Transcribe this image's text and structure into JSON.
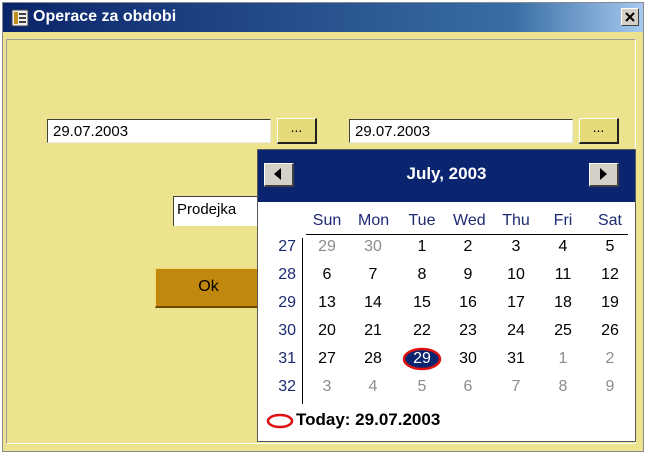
{
  "window": {
    "title": "Operace za obdobi"
  },
  "filters": {
    "date_from": "29.07.2003",
    "date_to": "29.07.2003",
    "picker_button_label": "...",
    "type_value": "Prodejka",
    "ok_label": "Ok"
  },
  "calendar": {
    "month_label": "July, 2003",
    "weekdays": [
      "Sun",
      "Mon",
      "Tue",
      "Wed",
      "Thu",
      "Fri",
      "Sat"
    ],
    "weeks": [
      {
        "num": "27",
        "days": [
          "29",
          "30",
          "1",
          "2",
          "3",
          "4",
          "5"
        ]
      },
      {
        "num": "28",
        "days": [
          "6",
          "7",
          "8",
          "9",
          "10",
          "11",
          "12"
        ]
      },
      {
        "num": "29",
        "days": [
          "13",
          "14",
          "15",
          "16",
          "17",
          "18",
          "19"
        ]
      },
      {
        "num": "30",
        "days": [
          "20",
          "21",
          "22",
          "23",
          "24",
          "25",
          "26"
        ]
      },
      {
        "num": "31",
        "days": [
          "27",
          "28",
          "29",
          "30",
          "31",
          "1",
          "2"
        ]
      },
      {
        "num": "32",
        "days": [
          "3",
          "4",
          "5",
          "6",
          "7",
          "8",
          "9"
        ]
      }
    ],
    "selected_day": "29",
    "today_label": "Today: 29.07.2003",
    "colors": {
      "header": "#0a2470",
      "today_circle": "#e01010",
      "weekday_text": "#1c2a72"
    }
  },
  "icons": {
    "title": "app-icon",
    "close": "close-icon",
    "prev": "arrow-left-icon",
    "next": "arrow-right-icon",
    "today": "today-circle-icon"
  }
}
